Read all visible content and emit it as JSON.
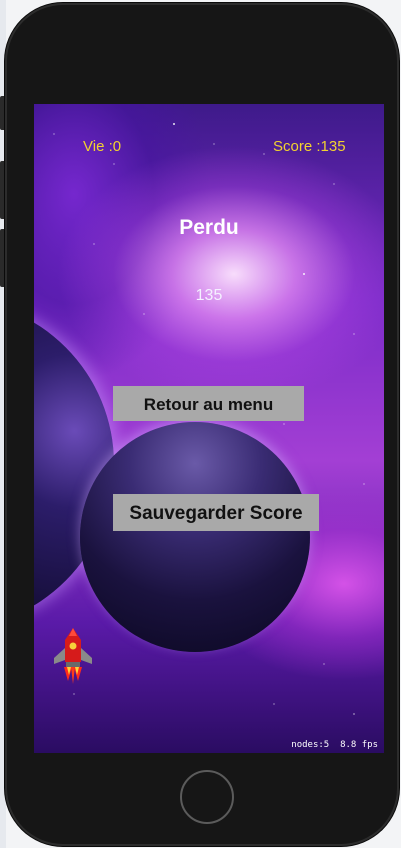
{
  "hud": {
    "lives_label": "Vie :0",
    "score_label": "Score :135"
  },
  "game_over": {
    "title": "Perdu",
    "final_score": "135"
  },
  "buttons": {
    "menu_label": "Retour au menu",
    "save_label": "Sauvegarder Score"
  },
  "debug": {
    "nodes": "nodes:5",
    "fps": "8.8 fps"
  },
  "colors": {
    "hud_text": "#f2d230",
    "button_bg": "#a9a9a9",
    "phone_body": "#161616"
  },
  "icons": {
    "player_ship": "rocket-ship-icon",
    "home": "home-button"
  }
}
